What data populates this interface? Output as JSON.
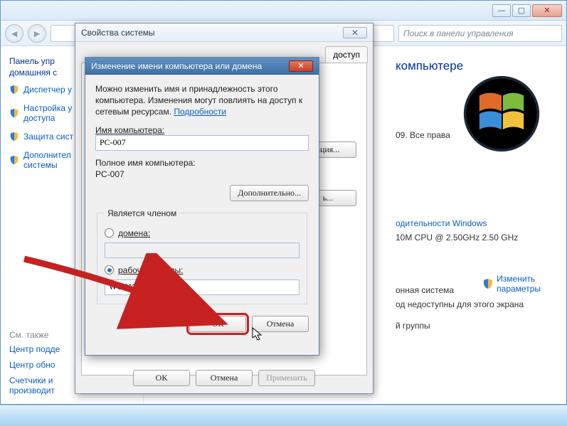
{
  "search": {
    "placeholder": "Поиск в панели управления"
  },
  "sidebar": {
    "cp_home1": "Панель упр",
    "cp_home2": "домашняя с",
    "links": [
      "Диспетчер у",
      "Настройка у\nдоступа",
      "Защита сист",
      "Дополнител\nсистемы"
    ],
    "seealso_title": "См. также",
    "seealso": [
      "Центр подде",
      "Центр обно",
      "Счетчики и\nпроизводит"
    ]
  },
  "content": {
    "heading": "компьютере",
    "copyright": "09. Все права",
    "perf_link": "одительности Windows",
    "cpu": "10M CPU @ 2.50GHz   2.50 GHz",
    "os_line": "онная система",
    "display_line": "од недоступны для этого экрана",
    "group_line": "й группы",
    "change_link": "Изменить\nпараметры"
  },
  "dlg1": {
    "title": "Свойства системы",
    "tab_visible": "доступ",
    "btn_id": "ация...",
    "btn_change": "ь...",
    "ok": "ОК",
    "cancel": "Отмена",
    "apply": "Применить"
  },
  "dlg2": {
    "title": "Изменение имени компьютера или домена",
    "desc": "Можно изменить имя и принадлежность этого компьютера. Изменения могут повлиять на доступ к сетевым ресурсам. ",
    "details_link": "Подробности",
    "name_label": "Имя компьютера:",
    "name_value": "PC-007",
    "fullname_label": "Полное имя компьютера:",
    "fullname_value": "PC-007",
    "more": "Дополнительно...",
    "member_legend": "Является членом",
    "domain_label": "домена:",
    "workgroup_label": "рабочей группы:",
    "workgroup_value": "WORKGROUP",
    "ok": "ОК",
    "cancel": "Отмена"
  }
}
